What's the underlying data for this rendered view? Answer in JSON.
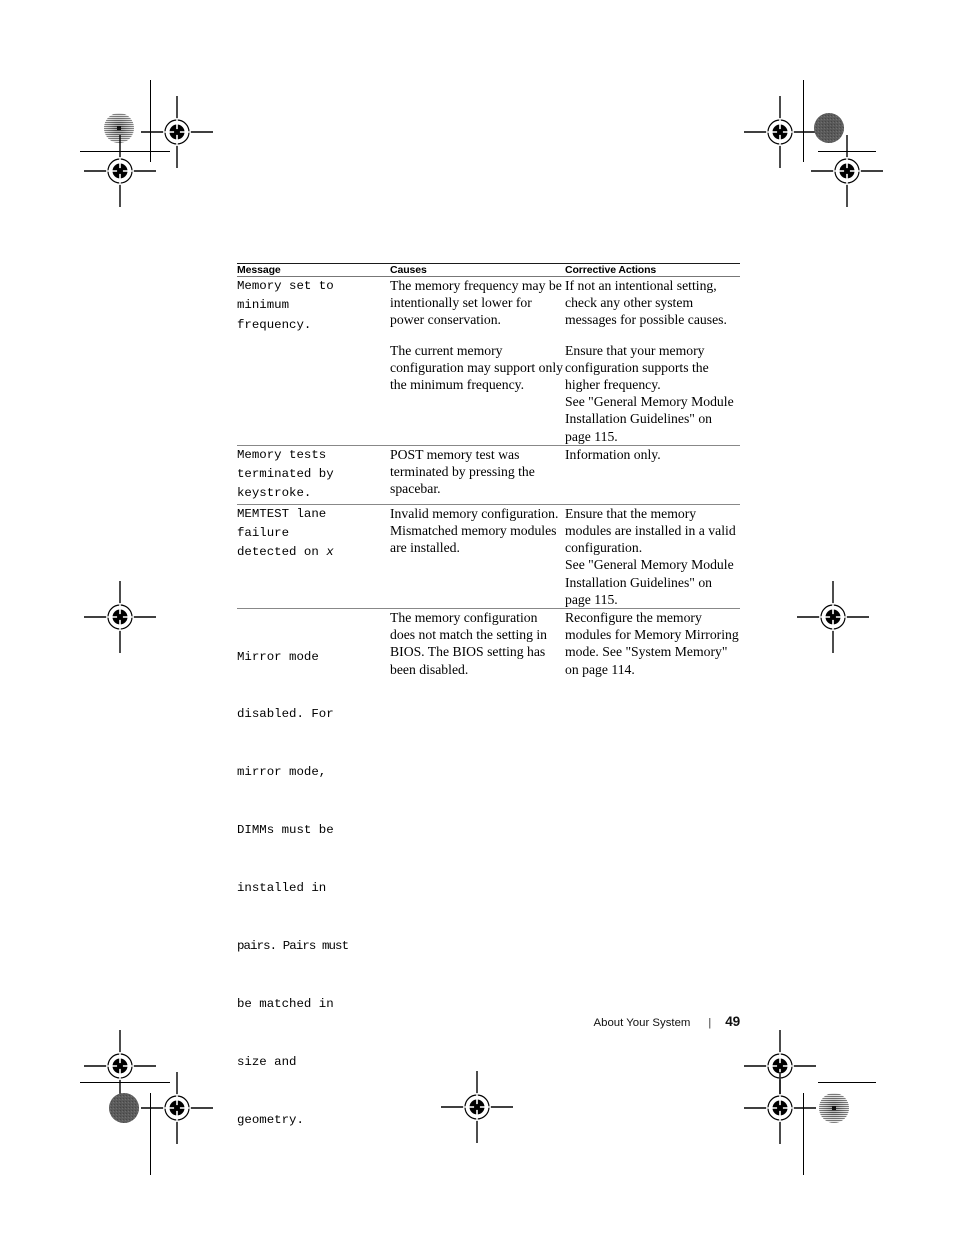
{
  "document": {
    "footer": {
      "section_label": "About Your System",
      "separator": "|",
      "page_number": "49"
    }
  },
  "table": {
    "headers": {
      "message": "Message",
      "causes": "Causes",
      "corrective_actions": "Corrective Actions"
    },
    "rows": [
      {
        "message": "Memory set to\nminimum\nfrequency.",
        "causes": [
          "The memory frequency may be intentionally set lower for power conservation.",
          "The current memory configuration may support only the minimum frequency."
        ],
        "corrective_actions": [
          "If not an intentional setting, check any other system messages for possible causes.",
          "Ensure that your memory configuration supports the higher frequency.\nSee \"General Memory Module\nInstallation Guidelines\" on page 115."
        ]
      },
      {
        "message": "Memory tests\nterminated by\nkeystroke.",
        "causes": [
          "POST memory test was terminated by pressing the spacebar."
        ],
        "corrective_actions": [
          "Information only."
        ]
      },
      {
        "message": "MEMTEST lane\nfailure\ndetected on ",
        "message_italic_suffix": "x",
        "causes": [
          "Invalid memory configuration. Mismatched memory modules are installed."
        ],
        "corrective_actions": [
          "Ensure that the memory modules are installed in a valid configuration.\nSee \"General Memory Module\nInstallation Guidelines\" on page 115."
        ]
      },
      {
        "message_lines": [
          "Mirror mode",
          "disabled. For",
          "mirror mode,",
          "DIMMs must be",
          "installed in",
          "pairs. Pairs must",
          "be matched in",
          "size and",
          "geometry."
        ],
        "causes": [
          "The memory configuration does not match the setting in BIOS. The BIOS setting has been disabled."
        ],
        "corrective_actions": [
          "Reconfigure the memory modules for Memory Mirroring mode. See \"System Memory\" on page 114."
        ]
      }
    ]
  }
}
